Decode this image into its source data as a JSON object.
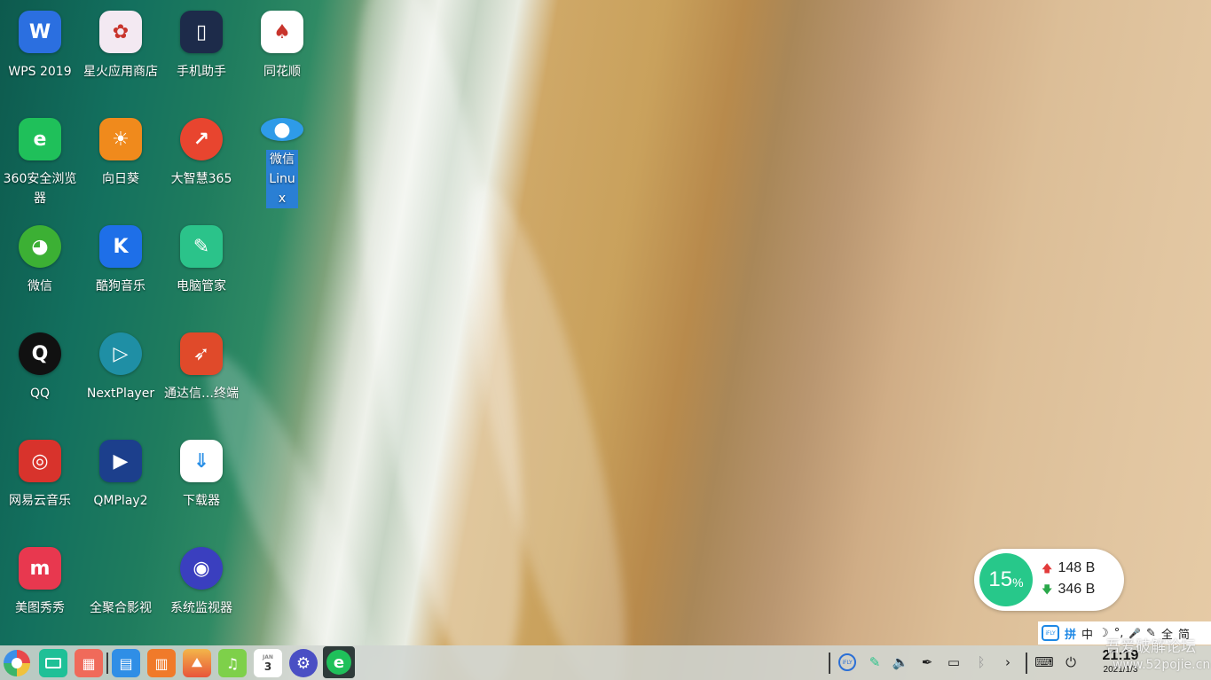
{
  "desktop": {
    "icons": [
      {
        "label": "WPS 2019",
        "icon": "wps-icon",
        "color": "#2b6fe0",
        "glyph": "W"
      },
      {
        "label": "360安全浏览器",
        "icon": "browser-360-icon",
        "color": "#1fc05a",
        "glyph": "e"
      },
      {
        "label": "微信",
        "icon": "wechat-icon",
        "color": "#3cb034",
        "glyph": "◕"
      },
      {
        "label": "QQ",
        "icon": "qq-penguin-icon",
        "color": "#222222",
        "glyph": "Q"
      },
      {
        "label": "网易云音乐",
        "icon": "netease-music-icon",
        "color": "#d8332c",
        "glyph": "◎"
      },
      {
        "label": "美图秀秀",
        "icon": "meitu-icon",
        "color": "#e8384f",
        "glyph": "m"
      },
      {
        "label": "星火应用商店",
        "icon": "spark-store-icon",
        "color": "#f3e9f2",
        "glyph": "✿"
      },
      {
        "label": "向日葵",
        "icon": "sunflower-icon",
        "color": "#f08a1c",
        "glyph": "☀"
      },
      {
        "label": "酷狗音乐",
        "icon": "kugou-music-icon",
        "color": "#1e6fe8",
        "glyph": "K"
      },
      {
        "label": "NextPlayer",
        "icon": "nextplayer-icon",
        "color": "#1f8fa5",
        "glyph": "▷"
      },
      {
        "label": "QMPlay2",
        "icon": "qmplay-icon",
        "color": "#1c3f8c",
        "glyph": "▶"
      },
      {
        "label": "全聚合影视",
        "icon": "video-aggregator-icon",
        "color": "transparent",
        "glyph": ""
      },
      {
        "label": "手机助手",
        "icon": "phone-assistant-icon",
        "color": "#1d2b4a",
        "glyph": "▯"
      },
      {
        "label": "大智慧365",
        "icon": "dazhihui-icon",
        "color": "#e8452f",
        "glyph": "↗"
      },
      {
        "label": "电脑管家",
        "icon": "pc-manager-icon",
        "color": "#2bc38a",
        "glyph": "✎"
      },
      {
        "label": "通达信…终端",
        "icon": "tongdaxin-icon",
        "color": "#e04a2a",
        "glyph": "➶"
      },
      {
        "label": "下载器",
        "icon": "downloader-icon",
        "color": "#ffffff",
        "glyph": "⇓"
      },
      {
        "label": "系统监视器",
        "icon": "system-monitor-icon",
        "color": "#3a3fbf",
        "glyph": "◉"
      },
      {
        "label": "同花顺",
        "icon": "tonghuashun-icon",
        "color": "#ffffff",
        "glyph": "♠"
      },
      {
        "label": "微信 Linux",
        "icon": "wechat-linux-icon",
        "color": "#2e9be8",
        "glyph": "●"
      }
    ]
  },
  "net_widget": {
    "cpu_value": "15",
    "cpu_unit": "%",
    "upload": "148 B",
    "download": "346 B",
    "upload_arrow": "🡅",
    "download_arrow": "🡇"
  },
  "ime": {
    "pinyin": "拼",
    "lang": "中",
    "moon": "☽",
    "punct": "°,",
    "mic": "🎤",
    "pen": "✎",
    "full": "全",
    "simp": "简"
  },
  "taskbar": {
    "clock_time": "21:19",
    "clock_date": "2021/1/3"
  },
  "watermark": {
    "line1": "吾爱破解论坛",
    "line2": "www.52pojie.cn"
  }
}
